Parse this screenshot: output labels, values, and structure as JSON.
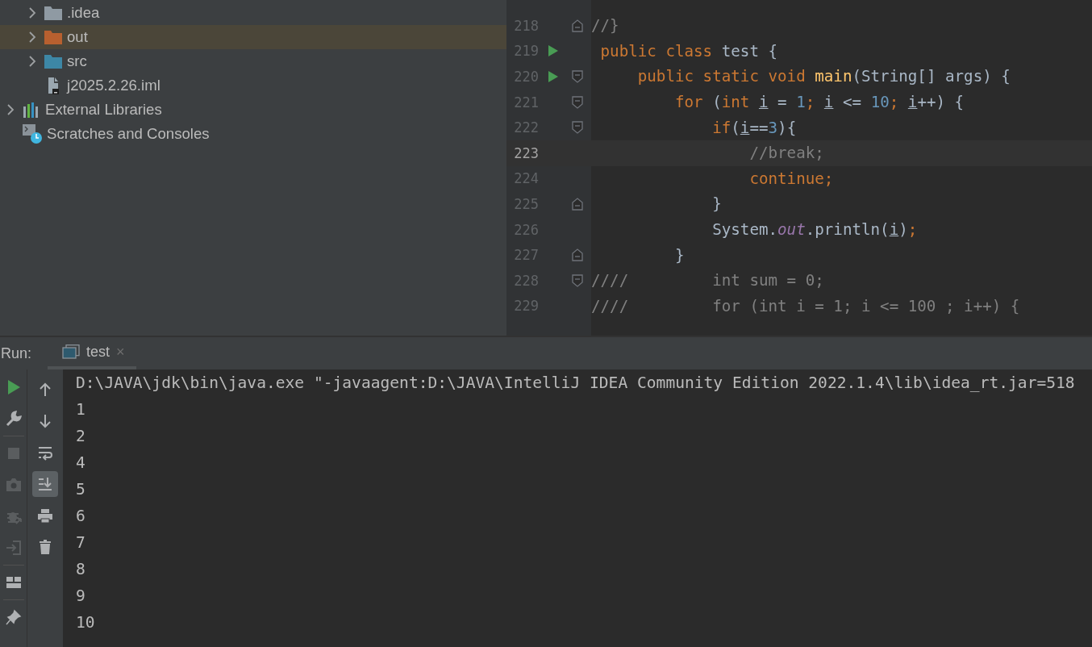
{
  "project_tree": {
    "project_contents": [
      {
        "label": ".idea",
        "kind": "folder",
        "color": "#8f9aa3",
        "expandable": true,
        "selected": false
      },
      {
        "label": "out",
        "kind": "folder",
        "color": "#b8602f",
        "expandable": true,
        "selected": true
      },
      {
        "label": "src",
        "kind": "folder",
        "color": "#3d87a6",
        "expandable": true,
        "selected": false
      },
      {
        "label": "j2025.2.26.iml",
        "kind": "file",
        "expandable": false,
        "selected": false
      }
    ],
    "top_level_items": [
      {
        "label": "External Libraries",
        "kind": "libraries",
        "expandable": true,
        "selected": false
      },
      {
        "label": "Scratches and Consoles",
        "kind": "scratches",
        "expandable": false,
        "selected": false
      }
    ]
  },
  "editor": {
    "lines": [
      {
        "number": "218",
        "current": false,
        "run": false,
        "fold_start": false,
        "fold_end": true,
        "tokens": [
          {
            "t": "//}",
            "kind": "comment"
          }
        ]
      },
      {
        "number": "219",
        "current": false,
        "run": true,
        "fold_start": false,
        "fold_end": false,
        "tokens": [
          {
            "t": " public class ",
            "kind": "keyword"
          },
          {
            "t": "test {",
            "kind": "plain"
          }
        ]
      },
      {
        "number": "220",
        "current": false,
        "run": true,
        "fold_start": true,
        "fold_end": false,
        "tokens": [
          {
            "t": "     public static void ",
            "kind": "keyword"
          },
          {
            "t": "main",
            "kind": "function"
          },
          {
            "t": "(String[] args) {",
            "kind": "plain"
          }
        ]
      },
      {
        "number": "221",
        "current": false,
        "run": false,
        "fold_start": true,
        "fold_end": false,
        "tokens": [
          {
            "t": "         for",
            "kind": "keyword"
          },
          {
            "t": " (",
            "kind": "plain"
          },
          {
            "t": "int ",
            "kind": "keyword"
          },
          {
            "t": "i",
            "kind": "variable"
          },
          {
            "t": " = ",
            "kind": "plain"
          },
          {
            "t": "1",
            "kind": "number"
          },
          {
            "t": "; ",
            "kind": "keyword"
          },
          {
            "t": "i",
            "kind": "variable"
          },
          {
            "t": " <= ",
            "kind": "plain"
          },
          {
            "t": "10",
            "kind": "number"
          },
          {
            "t": "; ",
            "kind": "keyword"
          },
          {
            "t": "i",
            "kind": "variable"
          },
          {
            "t": "++) {",
            "kind": "plain"
          }
        ]
      },
      {
        "number": "222",
        "current": false,
        "run": false,
        "fold_start": true,
        "fold_end": false,
        "tokens": [
          {
            "t": "             if",
            "kind": "keyword"
          },
          {
            "t": "(",
            "kind": "plain"
          },
          {
            "t": "i",
            "kind": "variable"
          },
          {
            "t": "==",
            "kind": "plain"
          },
          {
            "t": "3",
            "kind": "number"
          },
          {
            "t": "){",
            "kind": "plain"
          }
        ]
      },
      {
        "number": "223",
        "current": true,
        "run": false,
        "fold_start": false,
        "fold_end": false,
        "tokens": [
          {
            "t": "                 //break;",
            "kind": "comment"
          }
        ]
      },
      {
        "number": "224",
        "current": false,
        "run": false,
        "fold_start": false,
        "fold_end": false,
        "tokens": [
          {
            "t": "                 continue;",
            "kind": "keyword"
          }
        ]
      },
      {
        "number": "225",
        "current": false,
        "run": false,
        "fold_start": false,
        "fold_end": true,
        "tokens": [
          {
            "t": "             }",
            "kind": "plain"
          }
        ]
      },
      {
        "number": "226",
        "current": false,
        "run": false,
        "fold_start": false,
        "fold_end": false,
        "tokens": [
          {
            "t": "             System.",
            "kind": "plain"
          },
          {
            "t": "out",
            "kind": "field"
          },
          {
            "t": ".println(",
            "kind": "plain"
          },
          {
            "t": "i",
            "kind": "variable"
          },
          {
            "t": ")",
            "kind": "plain"
          },
          {
            "t": ";",
            "kind": "keyword"
          }
        ]
      },
      {
        "number": "227",
        "current": false,
        "run": false,
        "fold_start": false,
        "fold_end": true,
        "tokens": [
          {
            "t": "         }",
            "kind": "plain"
          }
        ]
      },
      {
        "number": "228",
        "current": false,
        "run": false,
        "fold_start": true,
        "fold_end": false,
        "tokens": [
          {
            "t": "////         int sum = 0;",
            "kind": "comment"
          }
        ]
      },
      {
        "number": "229",
        "current": false,
        "run": false,
        "fold_start": false,
        "fold_end": false,
        "tokens": [
          {
            "t": "////         for (int i = 1; i <= 100 ; i++) {",
            "kind": "comment"
          }
        ]
      }
    ]
  },
  "run_panel": {
    "label": "Run:",
    "tabs": [
      {
        "label": "test",
        "close": "×",
        "selected": true
      }
    ],
    "main_toolbar": [
      {
        "kind": "run",
        "disabled": false
      },
      {
        "kind": "wrench",
        "disabled": false
      },
      {
        "kind": "stop",
        "disabled": true
      },
      {
        "kind": "camera",
        "disabled": true
      },
      {
        "kind": "bug",
        "disabled": true
      },
      {
        "kind": "exit",
        "disabled": true
      },
      {
        "kind": "layout",
        "disabled": false
      },
      {
        "kind": "pin",
        "disabled": false
      }
    ],
    "console_toolbar": [
      {
        "kind": "up",
        "on": false
      },
      {
        "kind": "down",
        "on": false
      },
      {
        "kind": "wrap",
        "on": false
      },
      {
        "kind": "scroll-end",
        "on": true
      },
      {
        "kind": "print",
        "on": false
      },
      {
        "kind": "trash",
        "on": false
      }
    ],
    "output": [
      "D:\\JAVA\\jdk\\bin\\java.exe \"-javaagent:D:\\JAVA\\IntelliJ IDEA Community Edition 2022.1.4\\lib\\idea_rt.jar=518",
      "1",
      "2",
      "4",
      "5",
      "6",
      "7",
      "8",
      "9",
      "10"
    ]
  }
}
